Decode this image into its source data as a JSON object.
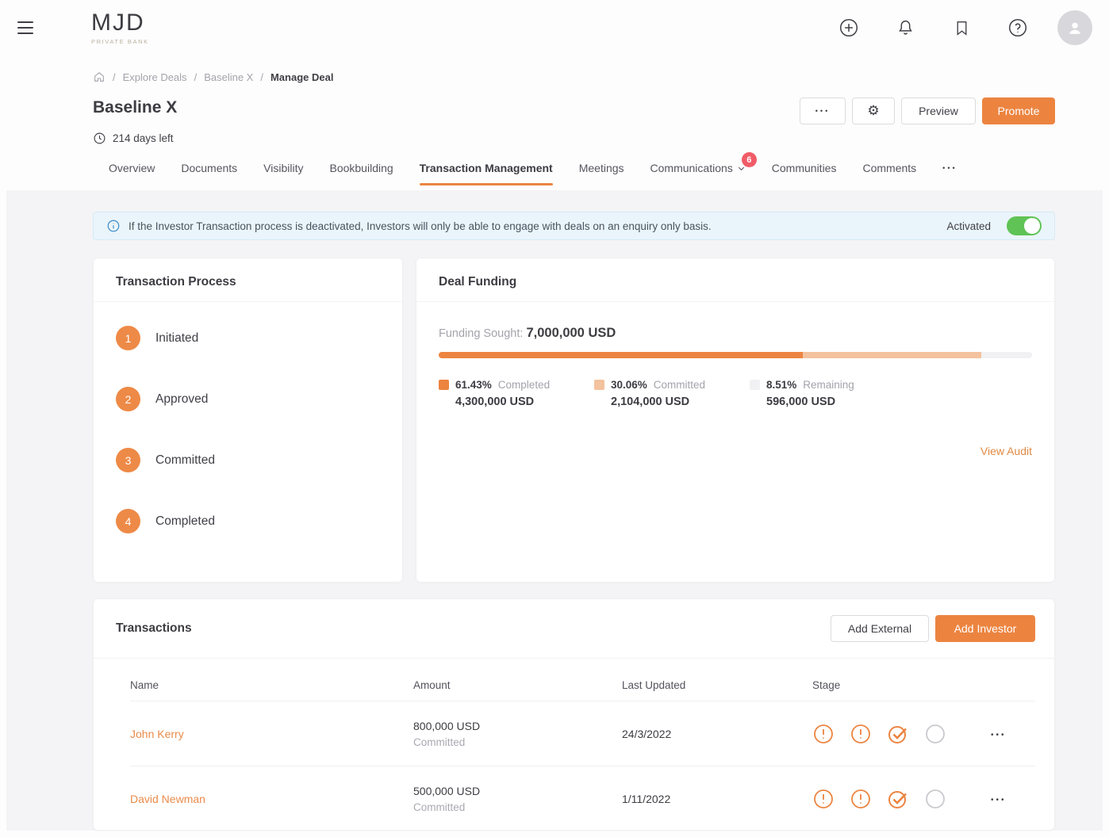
{
  "header": {
    "logo_name": "MJD",
    "logo_tagline": "PRIVATE BANK",
    "icons": [
      "add-icon",
      "bell-icon",
      "bookmark-icon",
      "help-icon",
      "avatar"
    ]
  },
  "breadcrumb": {
    "separator": "/",
    "items": {
      "0": "Explore Deals",
      "1": "Baseline X",
      "2": "Manage Deal"
    }
  },
  "page": {
    "title": "Baseline X",
    "days_left": "214 days left",
    "actions": {
      "more_label": "•••",
      "preview": "Preview",
      "promote": "Promote"
    }
  },
  "tabs": {
    "items": {
      "0": {
        "label": "Overview"
      },
      "1": {
        "label": "Documents"
      },
      "2": {
        "label": "Visibility"
      },
      "3": {
        "label": "Bookbuilding"
      },
      "4": {
        "label": "Transaction Management"
      },
      "5": {
        "label": "Meetings"
      },
      "6": {
        "label": "Communications",
        "badge": "6"
      },
      "7": {
        "label": "Communities"
      },
      "8": {
        "label": "Comments"
      },
      "9": {
        "label": "•••"
      }
    },
    "active": "Transaction Management"
  },
  "banner": {
    "text": "If the Investor Transaction process is deactivated, Investors will only be able to engage with deals on an enquiry only basis.",
    "toggle_label": "Activated",
    "toggle_state": "on"
  },
  "transaction_process": {
    "title": "Transaction Process",
    "steps": {
      "0": {
        "num": "1",
        "label": "Initiated"
      },
      "1": {
        "num": "2",
        "label": "Approved"
      },
      "2": {
        "num": "3",
        "label": "Committed"
      },
      "3": {
        "num": "4",
        "label": "Completed"
      }
    }
  },
  "deal_funding": {
    "title": "Deal Funding",
    "funding_sought_label": "Funding Sought:",
    "funding_sought_value": "7,000,000 USD",
    "progress": {
      "completed_pct": 61.43,
      "committed_pct": 30.06,
      "remaining_pct": 8.51
    },
    "legend": {
      "0": {
        "pct": "61.43%",
        "label": "Completed",
        "amount": "4,300,000 USD",
        "color": "#ec8440"
      },
      "1": {
        "pct": "30.06%",
        "label": "Committed",
        "amount": "2,104,000 USD",
        "color": "#f3c29e"
      },
      "2": {
        "pct": "8.51%",
        "label": "Remaining",
        "amount": "596,000 USD",
        "color": "#f1f1f3"
      }
    },
    "audit_link": "View Audit"
  },
  "transactions": {
    "title": "Transactions",
    "add_external": "Add External",
    "add_investor": "Add Investor",
    "columns": {
      "0": "Name",
      "1": "Amount",
      "2": "Last Updated",
      "3": "Stage"
    },
    "row_menu": "•••",
    "rows": {
      "0": {
        "name": "John Kerry",
        "amount": "800,000 USD",
        "status": "Committed",
        "last_updated": "24/3/2022"
      },
      "1": {
        "name": "David Newman",
        "amount": "500,000 USD",
        "status": "Committed",
        "last_updated": "1/11/2022"
      }
    }
  },
  "colors": {
    "accent_orange": "#ec8440",
    "committed_light": "#f3c29e",
    "remaining_grey": "#f1f1f3",
    "toggle_green": "#5fc355",
    "badge_red": "#f05c68",
    "banner_blue_bg": "#eaf5fb"
  }
}
